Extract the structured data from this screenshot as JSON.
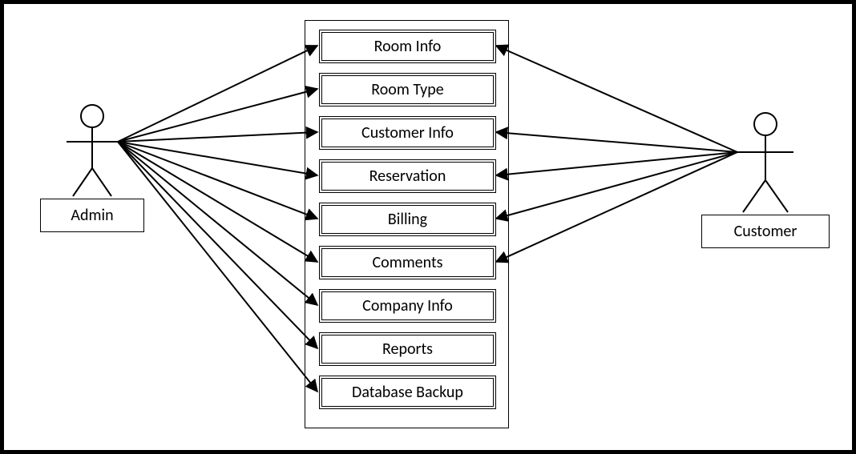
{
  "actors": {
    "left": {
      "label": "Admin"
    },
    "right": {
      "label": "Customer"
    }
  },
  "usecases": [
    "Room Info",
    "Room Type",
    "Customer Info",
    "Reservation",
    "Billing",
    "Comments",
    "Company Info",
    "Reports",
    "Database Backup"
  ],
  "connections": {
    "Admin": [
      "Room Info",
      "Room Type",
      "Customer Info",
      "Reservation",
      "Billing",
      "Comments",
      "Company Info",
      "Reports",
      "Database Backup"
    ],
    "Customer": [
      "Room Info",
      "Customer Info",
      "Reservation",
      "Billing",
      "Comments"
    ]
  }
}
